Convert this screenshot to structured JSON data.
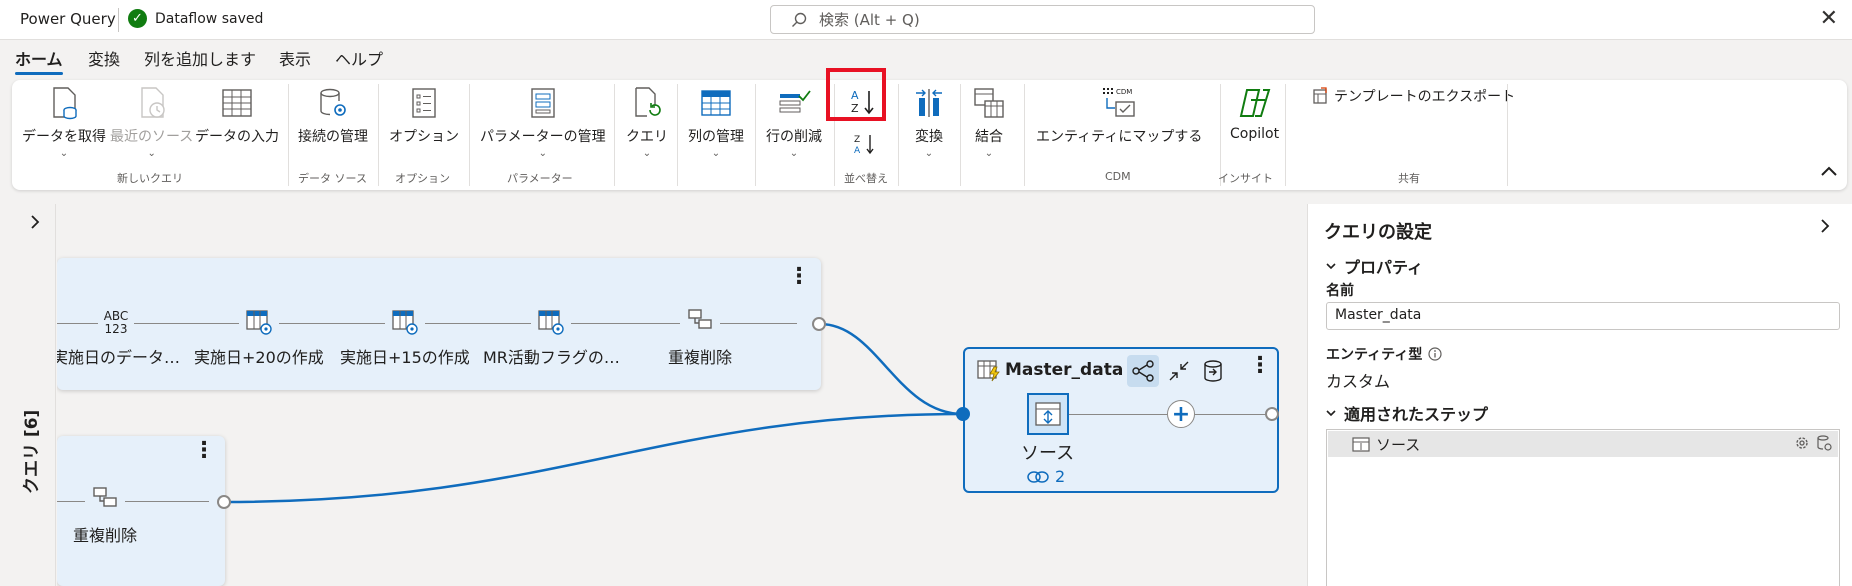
{
  "titlebar": {
    "app": "Power Query",
    "status": "Dataflow saved",
    "search_placeholder": "検索 (Alt + Q)",
    "close": "✕"
  },
  "tabs": [
    "ホーム",
    "変換",
    "列を追加します",
    "表示",
    "ヘルプ"
  ],
  "ribbon": {
    "get_data": "データを取得",
    "recent_sources": "最近のソース",
    "enter_data": "データの入力",
    "group_new_query": "新しいクエリ",
    "manage_connections": "接続の管理",
    "group_data_source": "データ ソース",
    "options": "オプション",
    "group_options": "オプション",
    "manage_parameters": "パラメーターの管理",
    "group_parameters": "パラメーター",
    "query": "クエリ",
    "manage_columns": "列の管理",
    "remove_rows": "行の削減",
    "group_sort": "並べ替え",
    "transform": "変換",
    "combine": "結合",
    "map_to_entity": "エンティティにマップする",
    "group_cdm": "CDM",
    "copilot": "Copilot",
    "group_insight": "インサイト",
    "export_template": "テンプレートのエクスポート",
    "group_share": "共有",
    "collapse": "^"
  },
  "left_pane": {
    "label": "クエリ [6]"
  },
  "canvas": {
    "card1_steps": [
      "実施日のデータ…",
      "実施日+20の作成",
      "実施日+15の作成",
      "MR活動フラグの…",
      "重複削除"
    ],
    "abc_top": "ABC",
    "abc_bottom": "123",
    "card2_steps": [
      "重複削除"
    ],
    "master": {
      "title": "Master_data",
      "step": "ソース",
      "link_count": "2"
    }
  },
  "settings": {
    "title": "クエリの設定",
    "properties": "プロパティ",
    "name_label": "名前",
    "name_value": "Master_data",
    "entity_type_label": "エンティティ型",
    "entity_type_value": "カスタム",
    "applied_steps": "適用されたステップ",
    "steps": [
      "ソース"
    ]
  },
  "colors": {
    "accent": "#0f6cbd",
    "highlight": "#e81123",
    "saved": "#107c10"
  }
}
